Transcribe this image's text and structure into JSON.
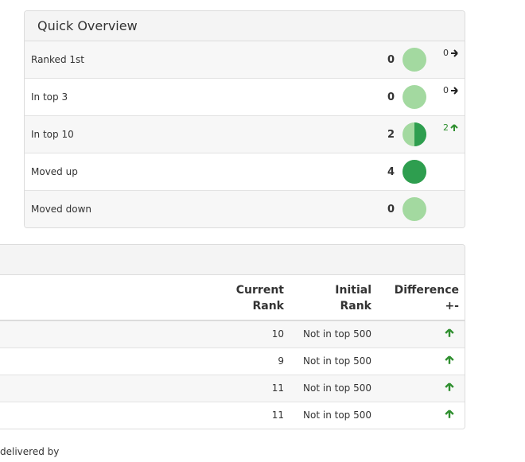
{
  "overview": {
    "title": "Quick Overview",
    "rows": [
      {
        "label": "Ranked 1st",
        "value": "0",
        "fill": 0,
        "change": "0",
        "change_dir": "neutral"
      },
      {
        "label": "In top 3",
        "value": "0",
        "fill": 0,
        "change": "0",
        "change_dir": "neutral"
      },
      {
        "label": "In top 10",
        "value": "2",
        "fill": 0.5,
        "change": "2",
        "change_dir": "up"
      },
      {
        "label": "Moved up",
        "value": "4",
        "fill": 1,
        "change": "",
        "change_dir": "none"
      },
      {
        "label": "Moved down",
        "value": "0",
        "fill": 0,
        "change": "",
        "change_dir": "none"
      }
    ]
  },
  "rankings": {
    "columns": [
      {
        "line1": "Current",
        "line2": "Rank"
      },
      {
        "line1": "Initial",
        "line2": "Rank"
      },
      {
        "line1": "Difference",
        "line2": "+-"
      }
    ],
    "rows": [
      {
        "current": "10",
        "initial": "Not in top 500",
        "difference": "up"
      },
      {
        "current": "9",
        "initial": "Not in top 500",
        "difference": "up"
      },
      {
        "current": "11",
        "initial": "Not in top 500",
        "difference": "up"
      },
      {
        "current": "11",
        "initial": "Not in top 500",
        "difference": "up"
      }
    ]
  },
  "footer": {
    "text": "delivered by"
  },
  "colors": {
    "light_green": "#a3d9a0",
    "dark_green": "#2e9e4f",
    "arrow_green": "#2f8f2f"
  }
}
